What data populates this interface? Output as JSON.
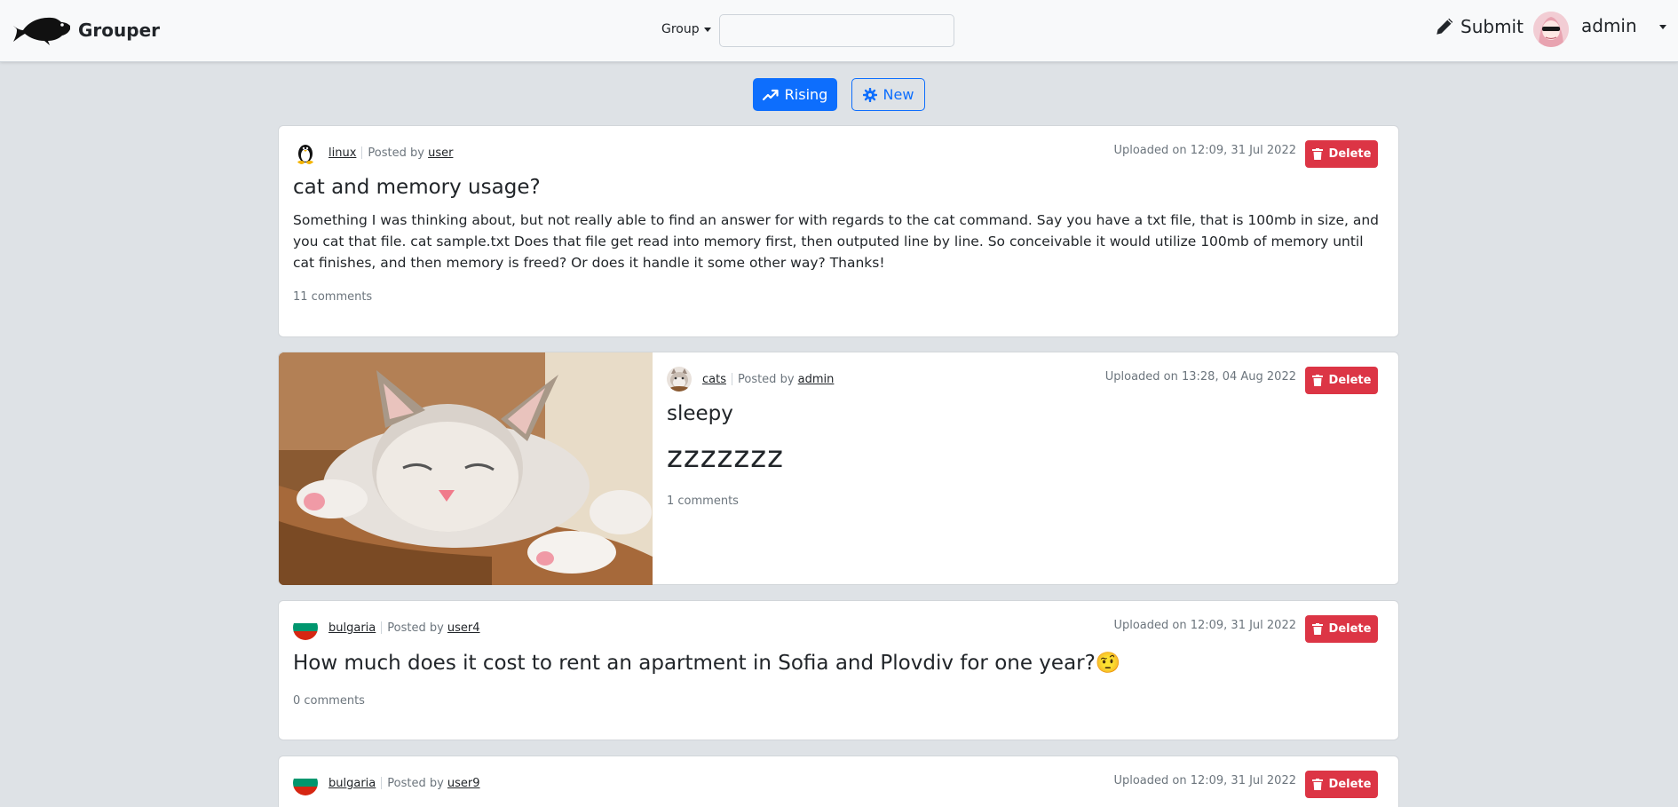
{
  "app": {
    "name": "Grouper",
    "logo_icon": "fish-icon"
  },
  "nav": {
    "group_dropdown": "Group",
    "search_placeholder": "",
    "submit_label": "Submit",
    "user_name": "admin"
  },
  "sort": {
    "rising_label": "Rising",
    "new_label": "New"
  },
  "posts": [
    {
      "group": "linux",
      "posted_by_prefix": "Posted by",
      "author": "user",
      "uploaded": "Uploaded on 12:09, 31 Jul 2022",
      "delete_label": "Delete",
      "title": "cat and memory usage?",
      "body": "Something I was thinking about, but not really able to find an answer for with regards to the cat command. Say you have a txt file, that is 100mb in size, and you cat that file. cat sample.txt Does that file get read into memory first, then outputed line by line. So conceivable it would utilize 100mb of memory until cat finishes, and then memory is freed? Or does it handle it some other way? Thanks!",
      "comments": "11 comments"
    },
    {
      "group": "cats",
      "posted_by_prefix": "Posted by",
      "author": "admin",
      "uploaded": "Uploaded on 13:28, 04 Aug 2022",
      "delete_label": "Delete",
      "title": "sleepy",
      "body": "zzzzzzz",
      "comments": "1 comments"
    },
    {
      "group": "bulgaria",
      "posted_by_prefix": "Posted by",
      "author": "user4",
      "uploaded": "Uploaded on 12:09, 31 Jul 2022",
      "delete_label": "Delete",
      "title": "How much does it cost to rent an apartment in Sofia and Plovdiv for one year?🤨",
      "comments": "0 comments"
    },
    {
      "group": "bulgaria",
      "posted_by_prefix": "Posted by",
      "author": "user9",
      "uploaded": "Uploaded on 12:09, 31 Jul 2022",
      "delete_label": "Delete"
    }
  ],
  "colors": {
    "primary": "#0d6efd",
    "danger": "#dc3545",
    "background": "#dee2e6",
    "navbar": "#f8f9fa"
  }
}
